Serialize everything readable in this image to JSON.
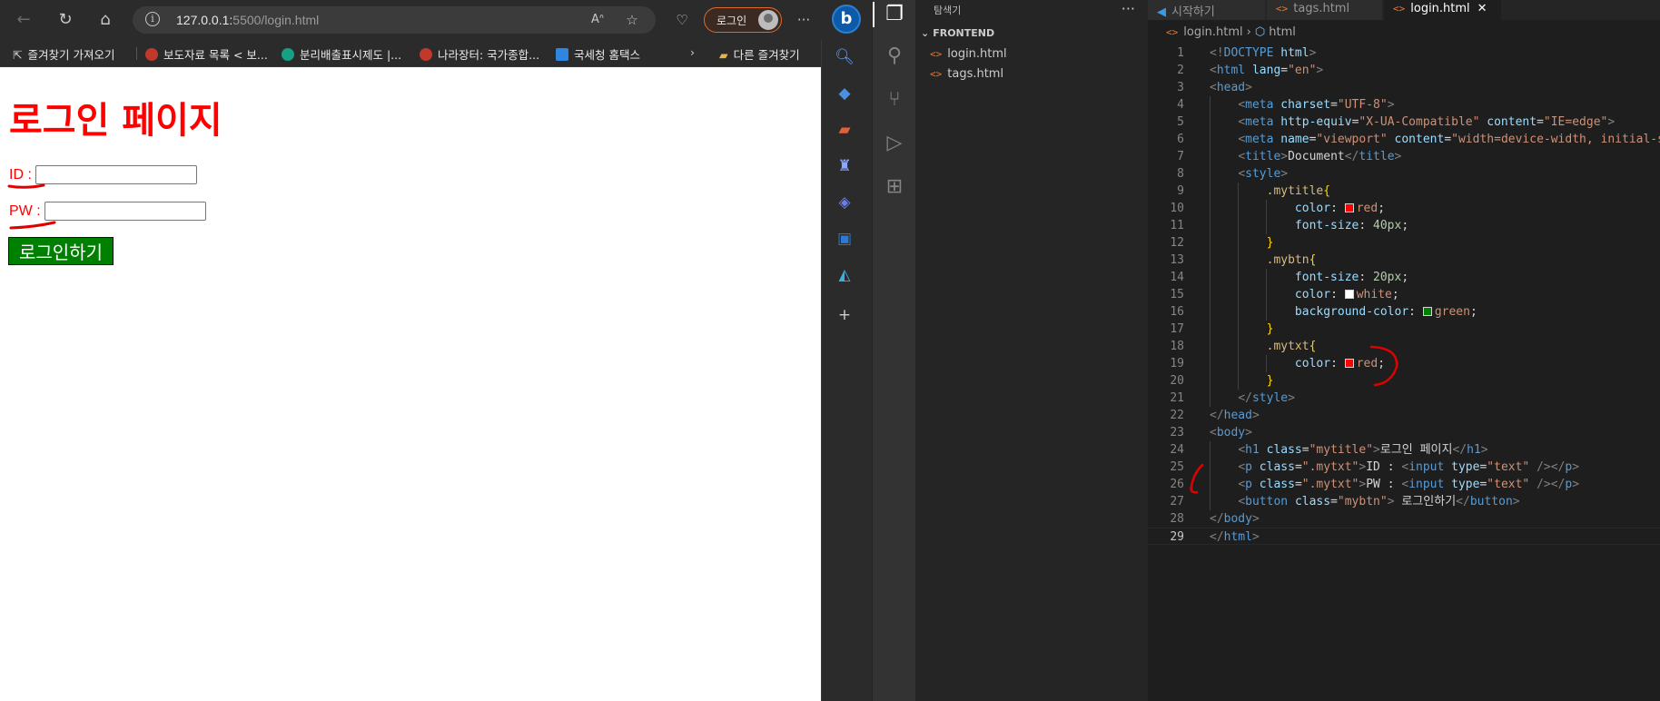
{
  "browser": {
    "url_host": "127.0.0.1:",
    "url_path": "5500/login.html",
    "profile_label": "로그인",
    "bing_label": "b",
    "favorites": [
      {
        "label": "즐겨찾기 가져오기",
        "color": "#ffffff"
      },
      {
        "label": "보도자료 목록 < 보...",
        "color": "#c0392b"
      },
      {
        "label": "분리배출표시제도 |...",
        "color": "#16a085"
      },
      {
        "label": "나라장터: 국가종합...",
        "color": "#c0392b"
      },
      {
        "label": "국세청 홈택스",
        "color": "#2e86de"
      }
    ],
    "more_favorites": "다른 즐겨찾기"
  },
  "page": {
    "title": "로그인 페이지",
    "id_label": "ID :",
    "pw_label": "PW :",
    "login_button": "로그인하기"
  },
  "explorer": {
    "title": "탐색기",
    "folder": "FRONTEND",
    "files": [
      "login.html",
      "tags.html"
    ]
  },
  "tabs": [
    {
      "label": "시작하기",
      "active": false
    },
    {
      "label": "tags.html",
      "active": false
    },
    {
      "label": "login.html",
      "active": true
    }
  ],
  "breadcrumb": {
    "file": "login.html",
    "node": "html"
  },
  "code": {
    "current_line": 29
  },
  "colors": {
    "red": "#ff0000",
    "green": "#008000",
    "white": "#ffffff",
    "annotation": "#e00000"
  }
}
